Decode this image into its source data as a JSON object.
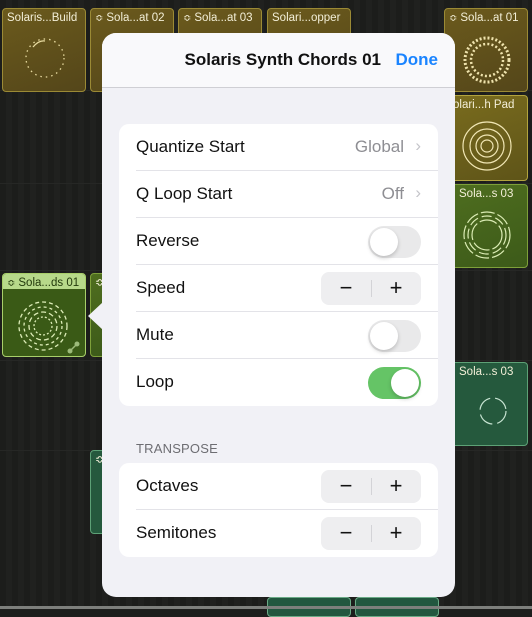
{
  "clips": [
    {
      "label": "Solaris...Build",
      "has_chevron": false
    },
    {
      "label": "Sola...at 02",
      "has_chevron": true
    },
    {
      "label": "Sola...at 03",
      "has_chevron": true
    },
    {
      "label": "Solari...opper",
      "has_chevron": false
    },
    {
      "label": "Sola...at 01",
      "has_chevron": true
    },
    {
      "label": "olari...h Pad",
      "has_chevron": false
    },
    {
      "label": "Sola...s 03",
      "has_chevron": false
    },
    {
      "label": "Sola...ds 01",
      "has_chevron": true
    },
    {
      "label": "Sola...s 03",
      "has_chevron": false
    }
  ],
  "chevron_glyph": "≎",
  "popover": {
    "title": "Solaris Synth Chords 01",
    "done_label": "Done",
    "settings": [
      {
        "label": "Quantize Start",
        "type": "disclosure",
        "value": "Global"
      },
      {
        "label": "Q Loop Start",
        "type": "disclosure",
        "value": "Off"
      },
      {
        "label": "Reverse",
        "type": "toggle",
        "on": false
      },
      {
        "label": "Speed",
        "type": "stepper"
      },
      {
        "label": "Mute",
        "type": "toggle",
        "on": false
      },
      {
        "label": "Loop",
        "type": "toggle",
        "on": true
      }
    ],
    "transpose_header": "TRANSPOSE",
    "transpose": [
      {
        "label": "Octaves",
        "type": "stepper"
      },
      {
        "label": "Semitones",
        "type": "stepper"
      }
    ],
    "minus_glyph": "−",
    "plus_glyph": "+",
    "chevron_right_glyph": "›"
  },
  "colors": {
    "accent": "#1a84ff",
    "toggle_on": "#65c466",
    "toggle_off": "#e9e9ea"
  }
}
